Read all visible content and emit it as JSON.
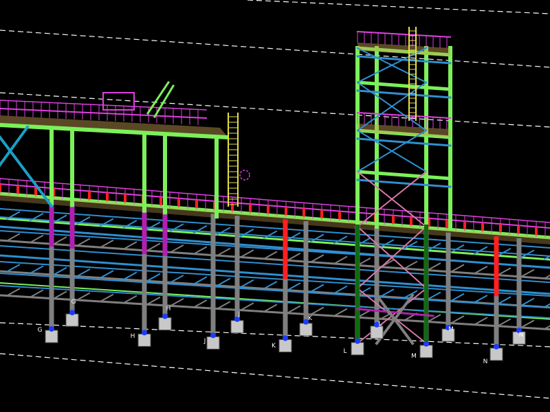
{
  "viewer": {
    "background": "#000000",
    "colors": {
      "column": "#7f7f7f",
      "main_frame": "#7cf05a",
      "secondary_beam": "#2f8fd0",
      "bracing": "#1aa0c8",
      "handrail": "#e040e0",
      "grating": "#c8a050",
      "highlight_red": "#ff2020",
      "highlight_magenta": "#b020b0",
      "cross_brace": "#d87aa8",
      "ladder": "#e6e04a",
      "pedestal": "#c8c8c8",
      "anchor": "#1a3cff",
      "gridline": "#ffffff",
      "dark_green": "#106a10"
    }
  },
  "grid_labels": {
    "upper": [
      "G",
      "H",
      "J",
      "K",
      "L",
      "M",
      "N"
    ],
    "lower": [
      "G",
      "H",
      "J",
      "K",
      "L",
      "M",
      "N"
    ]
  }
}
